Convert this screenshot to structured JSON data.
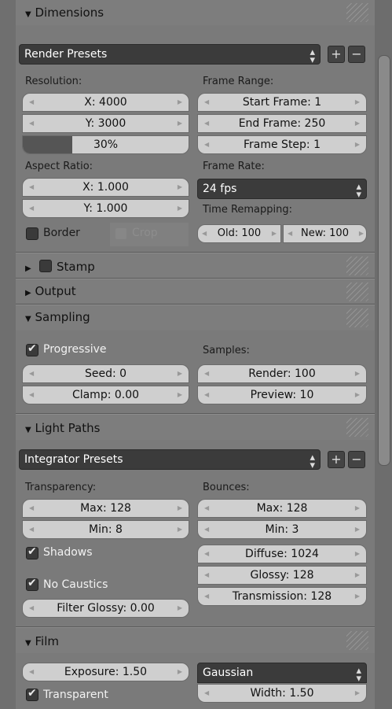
{
  "dimensions": {
    "title": "Dimensions",
    "render_presets": "Render Presets",
    "resolution_label": "Resolution:",
    "res_x": "X: 4000",
    "res_y": "Y: 3000",
    "res_pct": "30%",
    "res_pct_value": 0.3,
    "aspect_label": "Aspect Ratio:",
    "aspect_x": "X: 1.000",
    "aspect_y": "Y: 1.000",
    "border_label": "Border",
    "crop_label": "Crop",
    "frame_range_label": "Frame Range:",
    "start_frame": "Start Frame: 1",
    "end_frame": "End Frame: 250",
    "frame_step": "Frame Step: 1",
    "frame_rate_label": "Frame Rate:",
    "fps": "24 fps",
    "time_remap_label": "Time Remapping:",
    "old": "Old: 100",
    "new": "New: 100"
  },
  "stamp": {
    "title": "Stamp"
  },
  "output": {
    "title": "Output"
  },
  "sampling": {
    "title": "Sampling",
    "progressive_label": "Progressive",
    "seed": "Seed: 0",
    "clamp": "Clamp: 0.00",
    "samples_label": "Samples:",
    "render": "Render: 100",
    "preview": "Preview: 10"
  },
  "light_paths": {
    "title": "Light Paths",
    "integrator_presets": "Integrator Presets",
    "transparency_label": "Transparency:",
    "t_max": "Max: 128",
    "t_min": "Min: 8",
    "shadows_label": "Shadows",
    "no_caustics_label": "No Caustics",
    "filter_glossy": "Filter Glossy: 0.00",
    "bounces_label": "Bounces:",
    "b_max": "Max: 128",
    "b_min": "Min: 3",
    "diffuse": "Diffuse: 1024",
    "glossy": "Glossy: 128",
    "transmission": "Transmission: 128"
  },
  "film": {
    "title": "Film",
    "exposure": "Exposure: 1.50",
    "transparent_label": "Transparent",
    "filter": "Gaussian",
    "width": "Width: 1.50"
  },
  "glyphs": {
    "expanded": "▼",
    "collapsed": "▶",
    "plus": "+",
    "minus": "−",
    "updown": "⬍",
    "left": "◀",
    "right": "▶"
  }
}
